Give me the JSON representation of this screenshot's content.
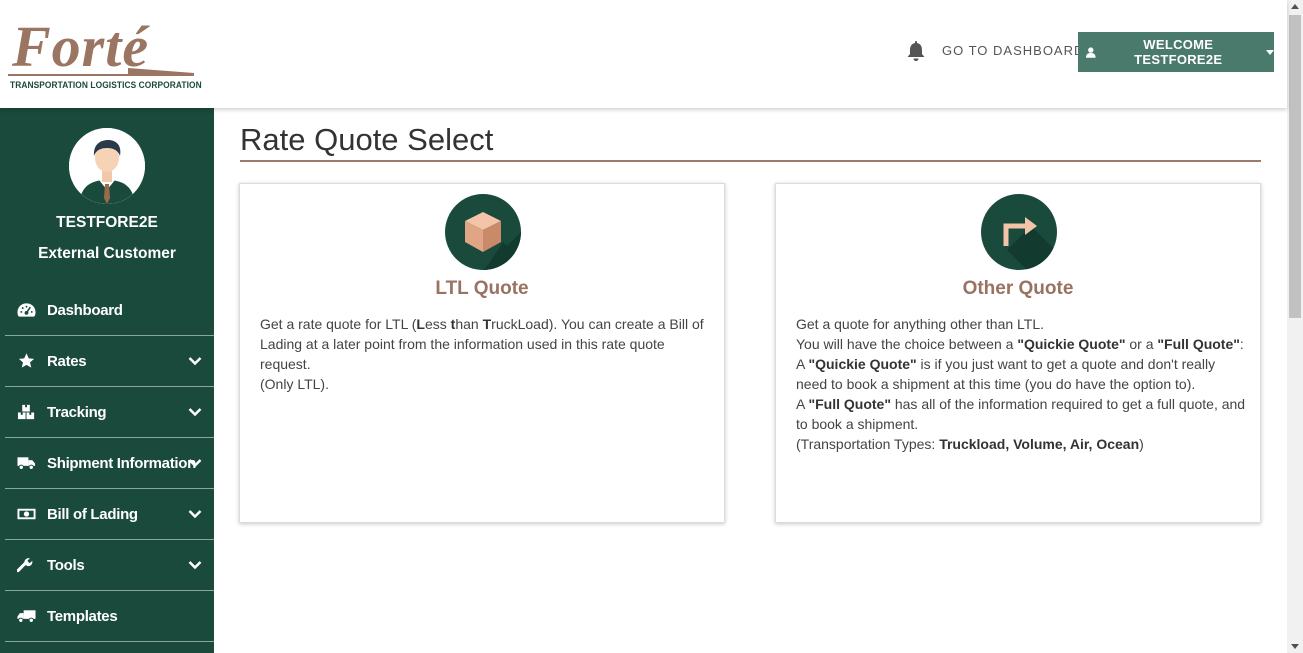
{
  "header": {
    "logo_text": "Forté",
    "logo_subtitle": "TRANSPORTATION LOGISTICS CORPORATION",
    "dashboard_link": "GO TO DASHBOARD",
    "welcome_label": "WELCOME TESTFORE2E"
  },
  "sidebar": {
    "user_name": "TESTFORE2E",
    "user_role": "External Customer",
    "items": [
      {
        "label": "Dashboard",
        "icon": "dashboard-icon",
        "expandable": false
      },
      {
        "label": "Rates",
        "icon": "star-icon",
        "expandable": true
      },
      {
        "label": "Tracking",
        "icon": "boxes-icon",
        "expandable": true
      },
      {
        "label": "Shipment Information",
        "icon": "truck-icon",
        "expandable": true
      },
      {
        "label": "Bill of Lading",
        "icon": "money-bill-icon",
        "expandable": true
      },
      {
        "label": "Tools",
        "icon": "wrench-icon",
        "expandable": true
      },
      {
        "label": "Templates",
        "icon": "truck-icon",
        "expandable": false
      }
    ]
  },
  "main": {
    "title": "Rate Quote Select",
    "cards": {
      "ltl": {
        "title": "LTL Quote",
        "icon": "cube-icon",
        "t1": "Get a rate quote for LTL (",
        "b1": "L",
        "t2": "ess ",
        "b2": "t",
        "t3": "han ",
        "b3": "T",
        "t4": "ruckLoad). You can create a Bill of Lading at a later point from the information used in this rate quote request.",
        "t5": "(Only LTL)."
      },
      "other": {
        "title": "Other Quote",
        "icon": "share-arrow-icon",
        "line1": "Get a quote for anything other than LTL.",
        "line2_pre": "You will have the choice between a ",
        "quickie": "\"Quickie Quote\"",
        "line2_mid": " or a ",
        "full": "\"Full Quote\"",
        "line2_end": ":",
        "line3_pre": "A ",
        "line3_rest": " is if you just want to get a quote and don't really need to book a shipment at this time (you do have the option to).",
        "line4_pre": "A ",
        "line4_rest": " has all of the information required to get a full quote, and to book a shipment.",
        "line5_pre": "(Transportation Types: ",
        "line5_types": "Truckload, Volume, Air, Ocean",
        "line5_end": ")"
      }
    }
  },
  "colors": {
    "brand_green": "#1a4a3c",
    "button_green": "#4a7a6c",
    "brand_brown": "#9a7262"
  }
}
